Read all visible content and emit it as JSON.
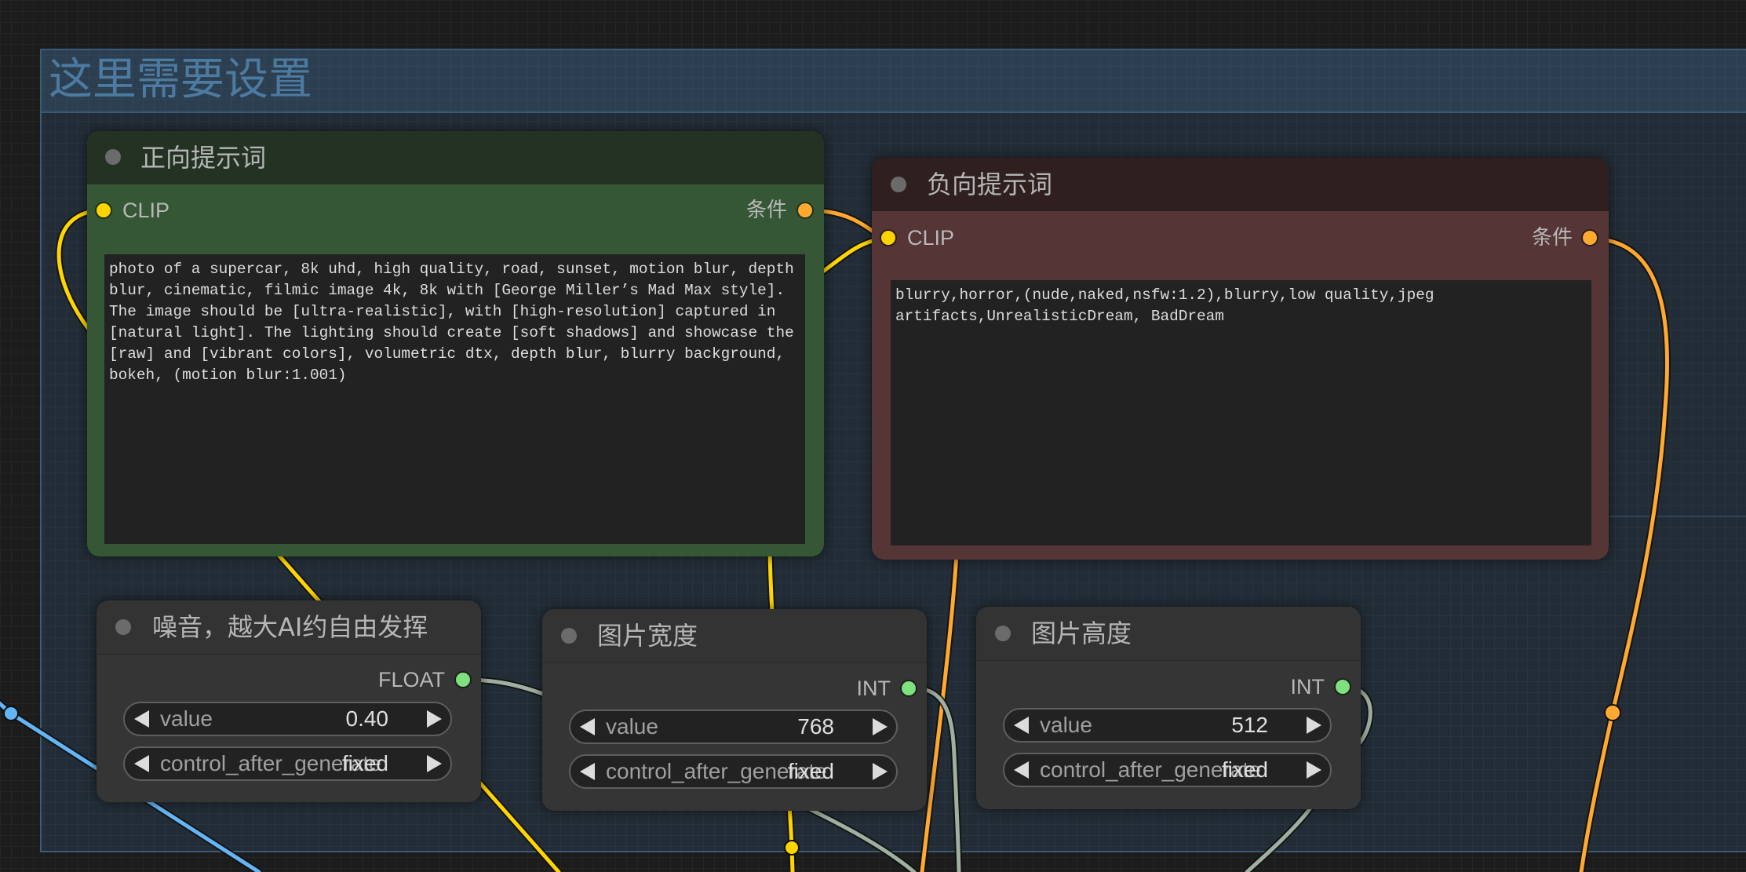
{
  "group": {
    "title": "这里需要设置"
  },
  "nodes": {
    "positive_prompt": {
      "title": "正向提示词",
      "input_label": "CLIP",
      "output_label": "条件",
      "text": "photo of a supercar, 8k uhd, high quality, road, sunset, motion blur, depth blur, cinematic, filmic image 4k, 8k with [George Miller’s Mad Max style]. The image should be [ultra-realistic], with [high-resolution] captured in [natural light]. The lighting should create [soft shadows] and showcase the [raw] and [vibrant colors], volumetric dtx, depth blur, blurry background, bokeh, (motion blur:1.001)"
    },
    "negative_prompt": {
      "title": "负向提示词",
      "input_label": "CLIP",
      "output_label": "条件",
      "text": "blurry,horror,(nude,naked,nsfw:1.2),blurry,low quality,jpeg artifacts,UnrealisticDream, BadDream"
    },
    "noise": {
      "title": "噪音，越大AI约自由发挥",
      "output_label": "FLOAT",
      "widgets": [
        {
          "label": "value",
          "value": "0.40"
        },
        {
          "label": "control_after_generate",
          "value": "fixed"
        }
      ]
    },
    "image_width": {
      "title": "图片宽度",
      "output_label": "INT",
      "widgets": [
        {
          "label": "value",
          "value": "768"
        },
        {
          "label": "control_after_generate",
          "value": "fixed"
        }
      ]
    },
    "image_height": {
      "title": "图片高度",
      "output_label": "INT",
      "widgets": [
        {
          "label": "value",
          "value": "512"
        },
        {
          "label": "control_after_generate",
          "value": "fixed"
        }
      ]
    }
  },
  "colors": {
    "clip_link": "#ffd500",
    "conditioning_link": "#ffa931",
    "number_link": "#a0b0a0",
    "blue_link": "#64b5f6",
    "group_title": "#4c7aa0"
  }
}
